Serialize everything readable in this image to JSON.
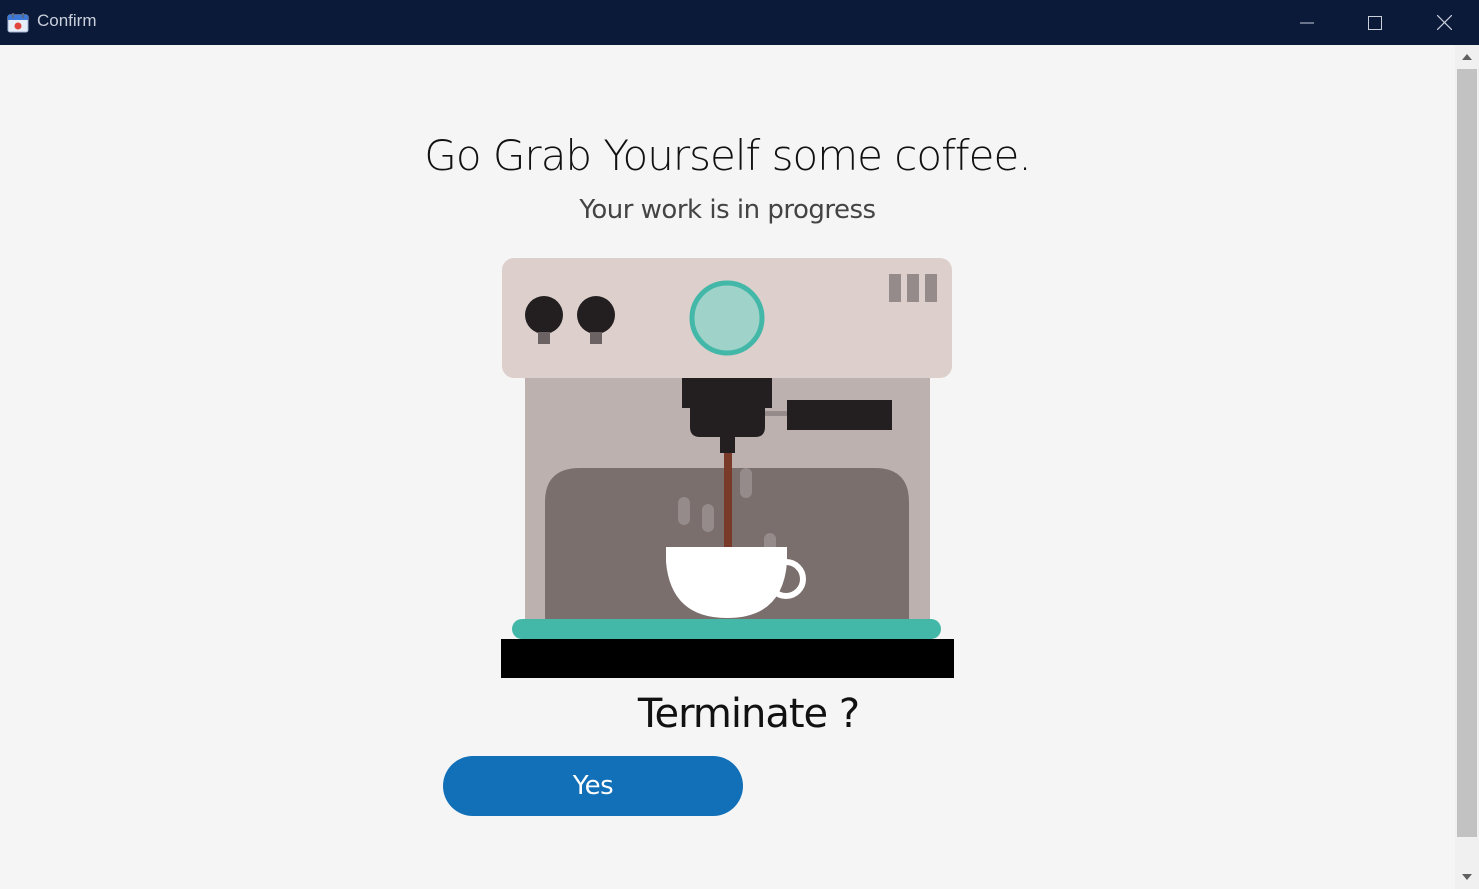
{
  "window": {
    "title": "Confirm"
  },
  "main": {
    "heading": "Go Grab Yourself some coffee.",
    "subheading": "Your work is in progress",
    "question": "Terminate ?",
    "yes_label": "Yes"
  },
  "colors": {
    "titlebar": "#0b1a38",
    "background": "#f5f5f5",
    "accent_button": "#1170b8",
    "machine_top": "#ddd0cc",
    "machine_body": "#bcb1af",
    "machine_cavity": "#7a6f6c",
    "teal": "#44b8a8",
    "coffee_stream": "#7a3a2a"
  },
  "icons": {
    "app": "app-calendar-icon",
    "minimize": "minimize-icon",
    "maximize": "maximize-icon",
    "close": "close-icon",
    "scroll_up": "chevron-up-icon",
    "scroll_down": "chevron-down-icon"
  }
}
